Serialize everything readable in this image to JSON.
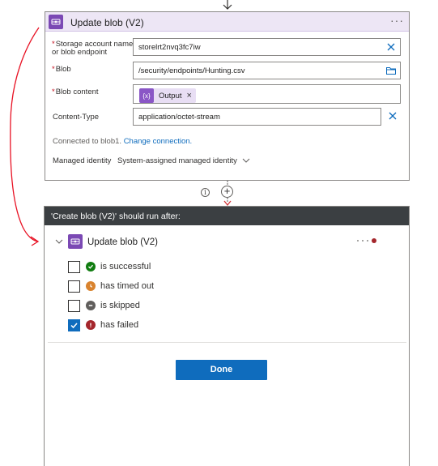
{
  "action_card": {
    "title": "Update blob (V2)",
    "more_label": "···",
    "fields": {
      "storage_account": {
        "label_line1": "Storage account name",
        "label_line2": "or blob endpoint",
        "value": "storelrt2nvq3fc7iw",
        "required": true
      },
      "blob": {
        "label": "Blob",
        "value": "/security/endpoints/Hunting.csv",
        "required": true
      },
      "blob_content": {
        "label": "Blob content",
        "token_label": "Output",
        "token_remove": "×",
        "required": true
      },
      "content_type": {
        "label": "Content-Type",
        "value": "application/octet-stream",
        "required": false
      }
    },
    "connection": {
      "text": "Connected to blob1.",
      "link": "Change connection."
    },
    "managed_identity": {
      "label": "Managed identity",
      "value": "System-assigned managed identity"
    }
  },
  "connector": {
    "add_label": "+",
    "info_label": "i"
  },
  "run_after_panel": {
    "header": "'Create blob (V2)' should run after:",
    "action_title": "Update blob (V2)",
    "options": [
      {
        "label": "is successful",
        "checked": false,
        "status": "success",
        "color": "#107c10"
      },
      {
        "label": "has timed out",
        "checked": false,
        "status": "timeout",
        "color": "#d9832e"
      },
      {
        "label": "is skipped",
        "checked": false,
        "status": "skipped",
        "color": "#605e5c"
      },
      {
        "label": "has failed",
        "checked": true,
        "status": "failed",
        "color": "#a4262c"
      }
    ],
    "done_label": "Done"
  },
  "colors": {
    "accent": "#0f6cbd",
    "connector_purple": "#7b49b4",
    "annotation_red": "#e81123",
    "panel_header": "#3b3f42"
  },
  "icons": {
    "action": "blob-storage-icon",
    "clear": "close-icon",
    "folder": "folder-icon",
    "expand": "chevron-down-icon"
  }
}
